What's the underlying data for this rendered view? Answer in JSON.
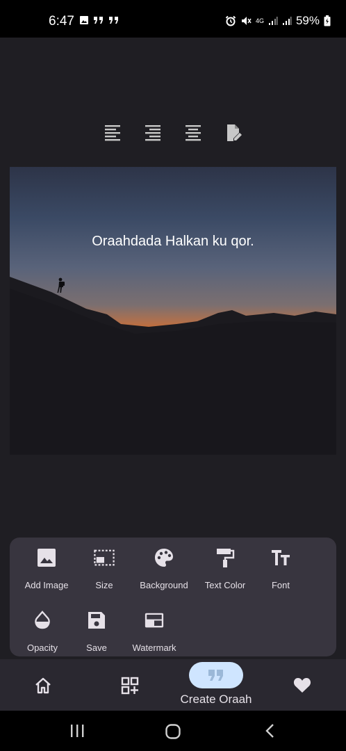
{
  "status_bar": {
    "time": "6:47",
    "battery": "59%",
    "network": "4G",
    "left_icons": [
      "image-icon",
      "quote-icon",
      "quote-icon"
    ],
    "right_icons": [
      "alarm-icon",
      "mute-icon",
      "signal-icon",
      "signal-icon",
      "battery-icon"
    ]
  },
  "align_toolbar": {
    "buttons": [
      "align-left-icon",
      "align-right-icon",
      "align-center-icon",
      "edit-text-icon"
    ]
  },
  "canvas": {
    "quote_text": "Oraahdada Halkan ku qor."
  },
  "tools": {
    "items": [
      {
        "label": "Add Image",
        "icon": "image-icon"
      },
      {
        "label": "Size",
        "icon": "resize-icon"
      },
      {
        "label": "Background",
        "icon": "palette-icon"
      },
      {
        "label": "Text Color",
        "icon": "paint-roller-icon"
      },
      {
        "label": "Font",
        "icon": "text-size-icon"
      },
      {
        "label": "Opacity",
        "icon": "opacity-icon"
      },
      {
        "label": "Save",
        "icon": "save-icon"
      },
      {
        "label": "Watermark",
        "icon": "watermark-icon"
      }
    ]
  },
  "bottom_nav": {
    "items": [
      {
        "icon": "home-icon"
      },
      {
        "icon": "add-grid-icon"
      },
      {
        "icon": "quote-icon",
        "label": "Create Oraah",
        "active": true
      },
      {
        "icon": "heart-icon"
      }
    ],
    "active_color": "#cfe5ff"
  },
  "system_nav": {
    "buttons": [
      "recents-icon",
      "home-circle-icon",
      "back-icon"
    ]
  }
}
